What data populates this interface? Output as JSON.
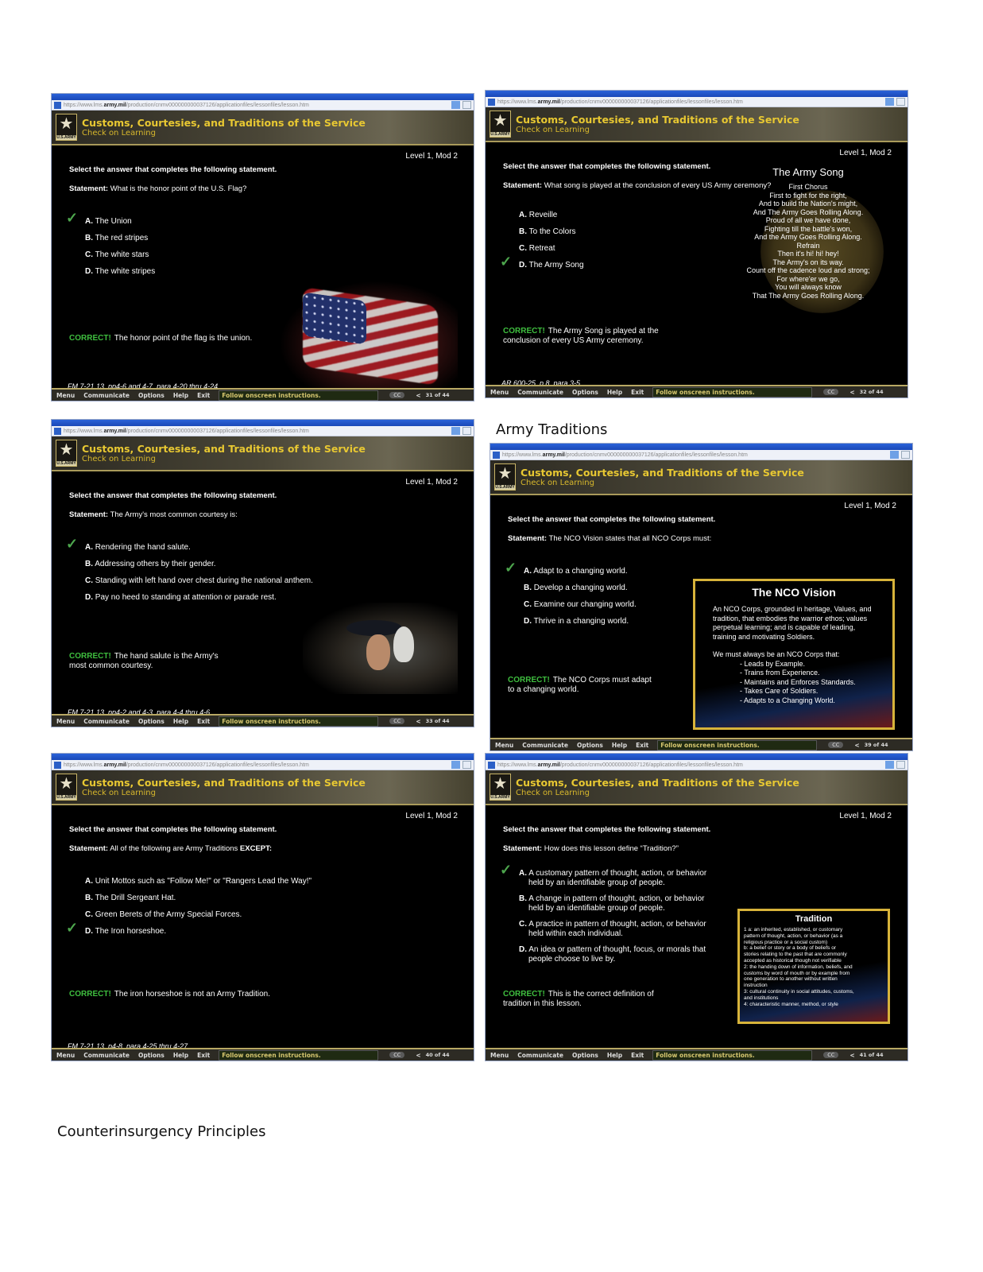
{
  "page": {
    "heading_army_traditions": "Army Traditions",
    "heading_counterinsurgency": "Counterinsurgency Principles"
  },
  "common": {
    "url_prefix": "https://www.lms.",
    "url_domain": "army.mil",
    "url_suffix": "/production/cnmv000000000037126/applicationfiles/lessonfiles/lesson.htm",
    "logo_caption": "U.S.ARMY",
    "course_title": "Customs, Courtesies, and Traditions of the Service",
    "section_title": "Check on Learning",
    "level": "Level 1, Mod 2",
    "instruction": "Select the answer that completes the following statement.",
    "statement_label": "Statement:",
    "correct_label": "CORRECT!",
    "toolbar": {
      "menu": "Menu",
      "communicate": "Communicate",
      "options": "Options",
      "help": "Help",
      "exit": "Exit",
      "status": "Follow onscreen instructions.",
      "cc": "CC",
      "prev_icon": "<"
    },
    "colors": {
      "accent_gold": "#e8c832",
      "correct_green": "#3fbf3f",
      "frame_gold": "#d7b33a"
    }
  },
  "slides": [
    {
      "statement": "What is the honor point of the U.S. Flag?",
      "options": [
        {
          "letter": "A.",
          "text": "The Union",
          "checked": true
        },
        {
          "letter": "B.",
          "text": "The red stripes",
          "checked": false
        },
        {
          "letter": "C.",
          "text": "The white stars",
          "checked": false
        },
        {
          "letter": "D.",
          "text": "The white stripes",
          "checked": false
        }
      ],
      "feedback": "The honor point of the flag is the union.",
      "reference": "FM 7-21.13, pp4-6 and 4-7, para 4-20 thru 4-24",
      "page": "31 of 44",
      "image": "us-flag"
    },
    {
      "statement": "What song is played at the conclusion of every US Army ceremony?",
      "options": [
        {
          "letter": "A.",
          "text": "Reveille",
          "checked": false
        },
        {
          "letter": "B.",
          "text": "To the Colors",
          "checked": false
        },
        {
          "letter": "C.",
          "text": "Retreat",
          "checked": false
        },
        {
          "letter": "D.",
          "text": "The Army Song",
          "checked": true
        }
      ],
      "feedback_line1": "The Army Song is played at the",
      "feedback_line2": "conclusion of every US Army ceremony.",
      "reference": "AR 600-25, p 8, para 3-5",
      "page": "32 of 44",
      "panel": {
        "title": "The Army Song",
        "lines": [
          "First Chorus",
          "First to fight for the right,",
          "And to build the Nation's might,",
          "And The Army Goes Rolling Along.",
          "Proud of all we have done,",
          "Fighting till the battle's won,",
          "And the Army Goes Rolling Along.",
          "Refrain",
          "Then it's hi! hi! hey!",
          "The Army's on its way.",
          "Count off the cadence loud and strong;",
          "For where'er we go,",
          "You will always know",
          "That The Army Goes Rolling Along."
        ]
      }
    },
    {
      "statement": "The Army's most common courtesy is:",
      "options": [
        {
          "letter": "A.",
          "text": "Rendering the hand salute.",
          "checked": true
        },
        {
          "letter": "B.",
          "text": "Addressing others by their gender.",
          "checked": false
        },
        {
          "letter": "C.",
          "text": "Standing with left hand over chest during the national anthem.",
          "checked": false
        },
        {
          "letter": "D.",
          "text": "Pay no heed to standing at attention or parade rest.",
          "checked": false
        }
      ],
      "feedback_line1": "The hand salute is the Army's",
      "feedback_line2": "most common courtesy.",
      "reference": "FM 7-21.13, pp4-2 and 4-3, para 4-4 thru 4-6",
      "page": "33 of 44",
      "image": "soldiers-saluting"
    },
    {
      "statement": "The NCO Vision states that all NCO Corps must:",
      "options": [
        {
          "letter": "A.",
          "text": "Adapt to a changing world.",
          "checked": true
        },
        {
          "letter": "B.",
          "text": "Develop a changing world.",
          "checked": false
        },
        {
          "letter": "C.",
          "text": "Examine our changing world.",
          "checked": false
        },
        {
          "letter": "D.",
          "text": "Thrive in a changing world.",
          "checked": false
        }
      ],
      "feedback_line1": "The NCO Corps must adapt",
      "feedback_line2": "to a changing world.",
      "page": "39 of 44",
      "panel": {
        "title": "The NCO Vision",
        "body": "An NCO Corps, grounded in heritage, Values, and tradition, that embodies the warrior ethos; values perpetual learning; and is capable of leading, training and motivating Soldiers.",
        "lead": "We must always be an NCO Corps that:",
        "bullets": [
          "- Leads by Example.",
          "- Trains from Experience.",
          "- Maintains and Enforces Standards.",
          "- Takes Care of Soldiers.",
          "- Adapts to a Changing World."
        ]
      }
    },
    {
      "statement": "All of the following are Army Traditions",
      "statement_emphasis": "EXCEPT:",
      "options": [
        {
          "letter": "A.",
          "text": "Unit Mottos such as \"Follow Me!\" or \"Rangers Lead the Way!\"",
          "checked": false
        },
        {
          "letter": "B.",
          "text": "The Drill Sergeant Hat.",
          "checked": false
        },
        {
          "letter": "C.",
          "text": "Green Berets of the Army Special Forces.",
          "checked": false
        },
        {
          "letter": "D.",
          "text": "The Iron horseshoe.",
          "checked": true
        }
      ],
      "feedback": "The iron horseshoe is not an Army Tradition.",
      "reference": "FM 7-21.13, p4-8, para 4-25 thru 4-27",
      "page": "40 of 44"
    },
    {
      "statement": "How does this lesson define “Tradition?”",
      "options": [
        {
          "letter": "A.",
          "text": "A customary pattern of thought, action, or behavior",
          "text2": "held by an identifiable group of people.",
          "checked": true
        },
        {
          "letter": "B.",
          "text": "A change in pattern of thought, action, or behavior",
          "text2": "held by an identifiable group of people.",
          "checked": false
        },
        {
          "letter": "C.",
          "text": "A practice in pattern of thought, action, or behavior",
          "text2": "held within each individual.",
          "checked": false
        },
        {
          "letter": "D.",
          "text": "An idea or pattern of thought, focus, or morals that",
          "text2": "people choose to live by.",
          "checked": false
        }
      ],
      "feedback_line1": "This is the correct definition of",
      "feedback_line2": "tradition in this lesson.",
      "page": "41 of 44",
      "panel": {
        "title": "Tradition",
        "lines": [
          "1 a:  an inherited, established, or customary",
          "pattern of thought, action, or behavior (as a",
          "religious practice or a social custom)",
          "   b:  a belief or story or a body of beliefs or",
          "stories relating to the past that are commonly",
          "accepted as historical though not verifiable",
          "2:  the handing down of information, beliefs, and",
          "customs by word of mouth or by example from",
          "one generation to another without written",
          "instruction",
          "3:  cultural continuity in social attitudes, customs,",
          "and institutions",
          "4:  characteristic manner, method, or style"
        ]
      }
    }
  ]
}
